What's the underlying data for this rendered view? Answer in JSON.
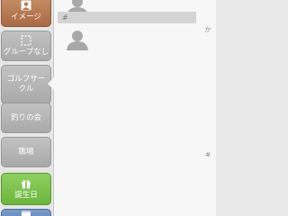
{
  "sidebar": {
    "items": [
      {
        "label": "イメージ",
        "icon": "portrait-icon"
      },
      {
        "label": "グループなし",
        "icon": "dashed-square-icon"
      },
      {
        "label": "ゴルフサークル",
        "icon": ""
      },
      {
        "label": "釣りの会",
        "icon": ""
      },
      {
        "label": "職場",
        "icon": ""
      },
      {
        "label": "誕生日",
        "icon": "gift-icon"
      },
      {
        "label": "",
        "icon": "calendar-icon"
      }
    ],
    "selected_index": 2
  },
  "list": {
    "section_header": "#"
  },
  "index_bar": {
    "letters": [
      "か",
      "#"
    ]
  },
  "colors": {
    "image_button": "#b57a52",
    "birthday_button": "#7cc24c",
    "group_button": "#b5b5b5",
    "bottom_button": "#6a8dbf"
  }
}
